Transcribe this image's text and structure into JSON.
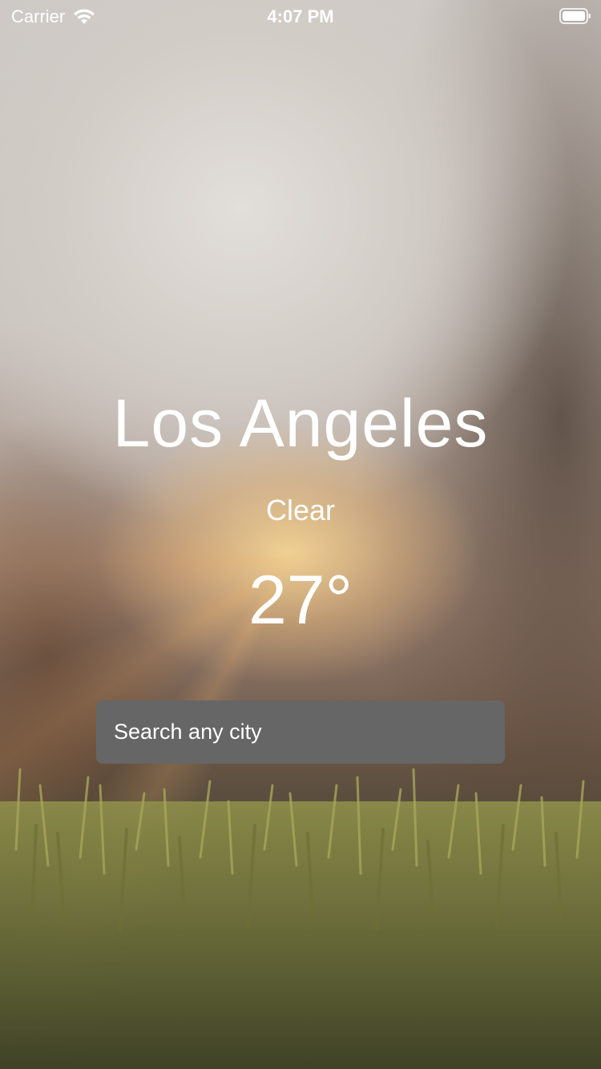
{
  "status_bar": {
    "carrier": "Carrier",
    "time": "4:07 PM",
    "wifi_icon": "wifi-icon",
    "battery_icon": "battery-icon"
  },
  "weather": {
    "city": "Los Angeles",
    "condition": "Clear",
    "temperature": "27°"
  },
  "search": {
    "placeholder": "Search any city",
    "value": ""
  },
  "colors": {
    "text": "#ffffff",
    "search_background": "#666666"
  }
}
